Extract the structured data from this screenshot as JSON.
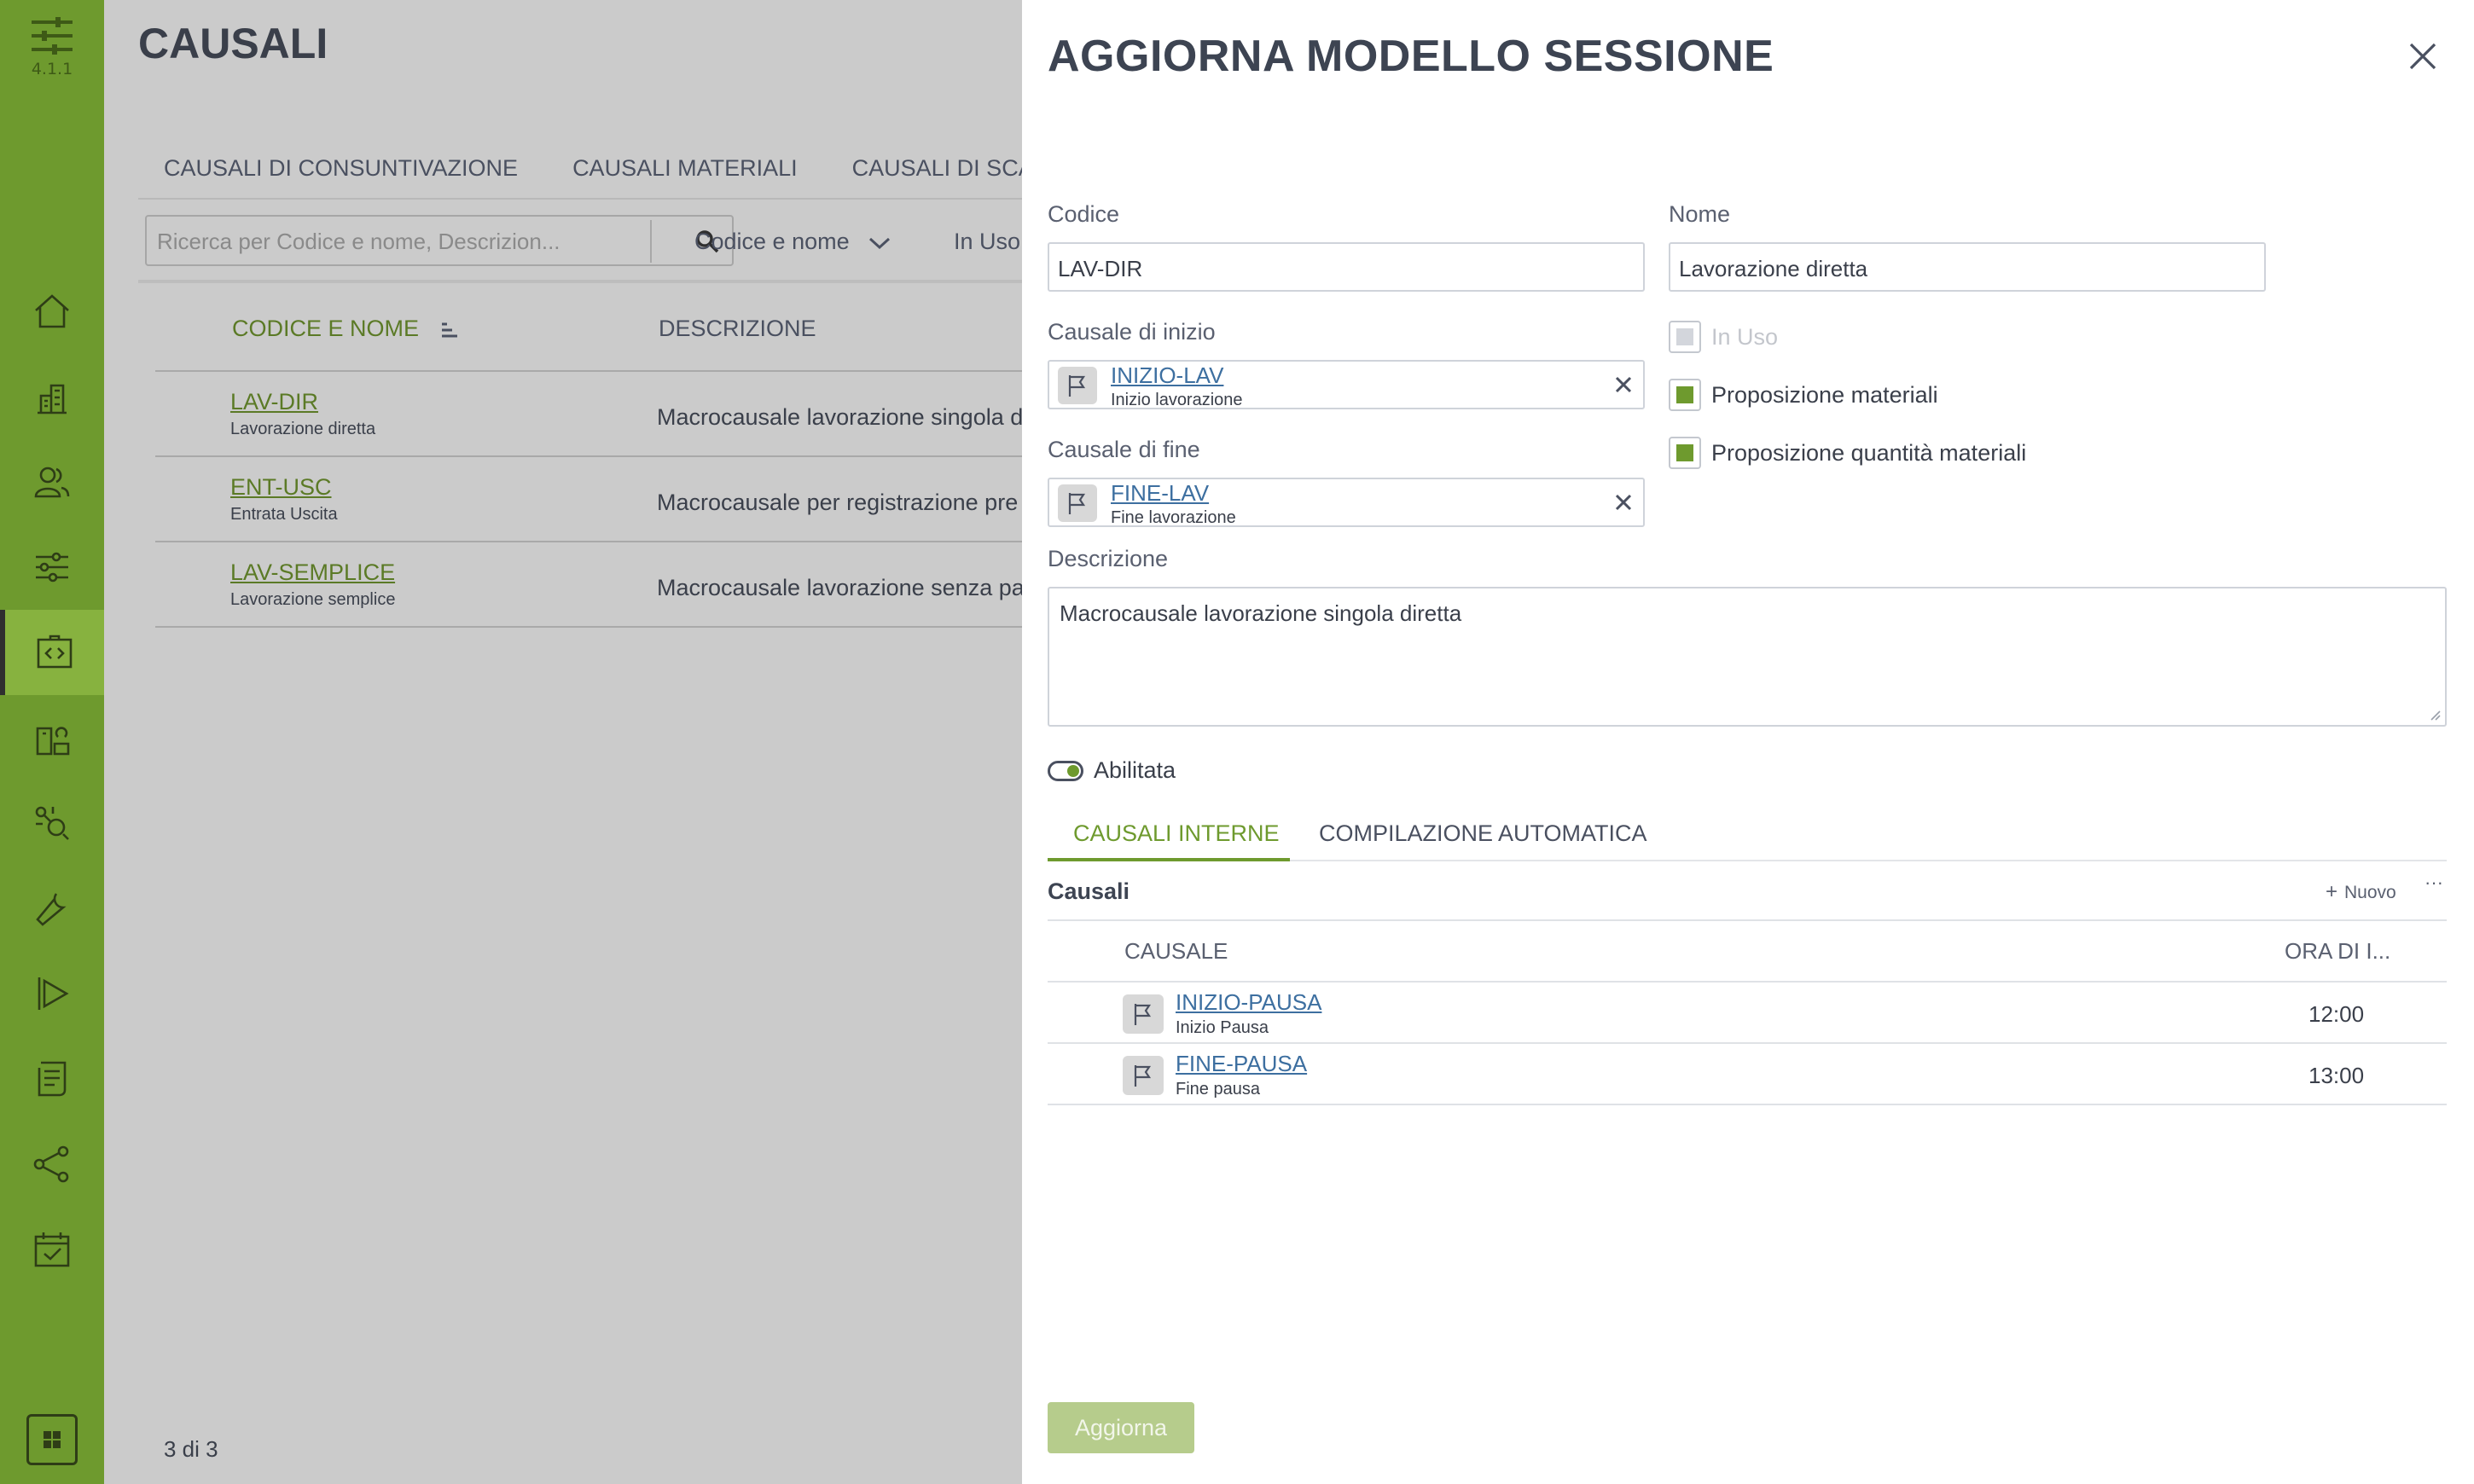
{
  "app": {
    "version": "4.1.1",
    "colors": {
      "brand": "#6e9a2e",
      "brand_active": "#87b23f",
      "link": "#3d6fa0"
    },
    "nav_items": [
      {
        "name": "home-icon"
      },
      {
        "name": "building-icon"
      },
      {
        "name": "users-icon"
      },
      {
        "name": "sliders-icon"
      },
      {
        "name": "code-card-icon",
        "active": true
      },
      {
        "name": "devices-icon"
      },
      {
        "name": "process-icon"
      },
      {
        "name": "wrench-icon"
      },
      {
        "name": "play-icon"
      },
      {
        "name": "document-icon"
      },
      {
        "name": "share-icon"
      },
      {
        "name": "calendar-check-icon"
      }
    ]
  },
  "page": {
    "title": "CAUSALI",
    "tabs": [
      "CAUSALI DI CONSUNTIVAZIONE",
      "CAUSALI MATERIALI",
      "CAUSALI DI SCART"
    ],
    "search": {
      "placeholder": "Ricerca per Codice e nome, Descrizion..."
    },
    "sort_label": "Codice e nome",
    "filter_label": "In Uso",
    "columns": {
      "code": "CODICE E NOME",
      "description": "DESCRIZIONE"
    },
    "rows": [
      {
        "code": "LAV-DIR",
        "name": "Lavorazione diretta",
        "description": "Macrocausale lavorazione singola d"
      },
      {
        "code": "ENT-USC",
        "name": "Entrata Uscita",
        "description": "Macrocausale per registrazione pre"
      },
      {
        "code": "LAV-SEMPLICE",
        "name": "Lavorazione semplice",
        "description": "Macrocausale lavorazione senza pa"
      }
    ],
    "count": "3 di 3"
  },
  "drawer": {
    "title": "AGGIORNA MODELLO SESSIONE",
    "fields": {
      "codice_label": "Codice",
      "codice_value": "LAV-DIR",
      "nome_label": "Nome",
      "nome_value": "Lavorazione diretta",
      "causale_inizio_label": "Causale di inizio",
      "causale_inizio_code": "INIZIO-LAV",
      "causale_inizio_name": "Inizio lavorazione",
      "causale_fine_label": "Causale di fine",
      "causale_fine_code": "FINE-LAV",
      "causale_fine_name": "Fine lavorazione",
      "descrizione_label": "Descrizione",
      "descrizione_value": "Macrocausale lavorazione singola diretta"
    },
    "checkboxes": {
      "in_uso": {
        "label": "In Uso",
        "checked": true,
        "disabled": true
      },
      "prop_materiali": {
        "label": "Proposizione materiali",
        "checked": true
      },
      "prop_quantita": {
        "label": "Proposizione quantità materiali",
        "checked": true
      }
    },
    "toggle": {
      "label": "Abilitata",
      "on": true
    },
    "tabs": {
      "active": "CAUSALI INTERNE",
      "other": "COMPILAZIONE AUTOMATICA"
    },
    "section": {
      "title": "Causali",
      "new_label": "Nuovo",
      "more_label": "···",
      "columns": {
        "causale": "CAUSALE",
        "ora": "ORA DI I..."
      },
      "rows": [
        {
          "code": "INIZIO-PAUSA",
          "name": "Inizio Pausa",
          "time": "12:00"
        },
        {
          "code": "FINE-PAUSA",
          "name": "Fine pausa",
          "time": "13:00"
        }
      ]
    },
    "submit_label": "Aggiorna"
  }
}
